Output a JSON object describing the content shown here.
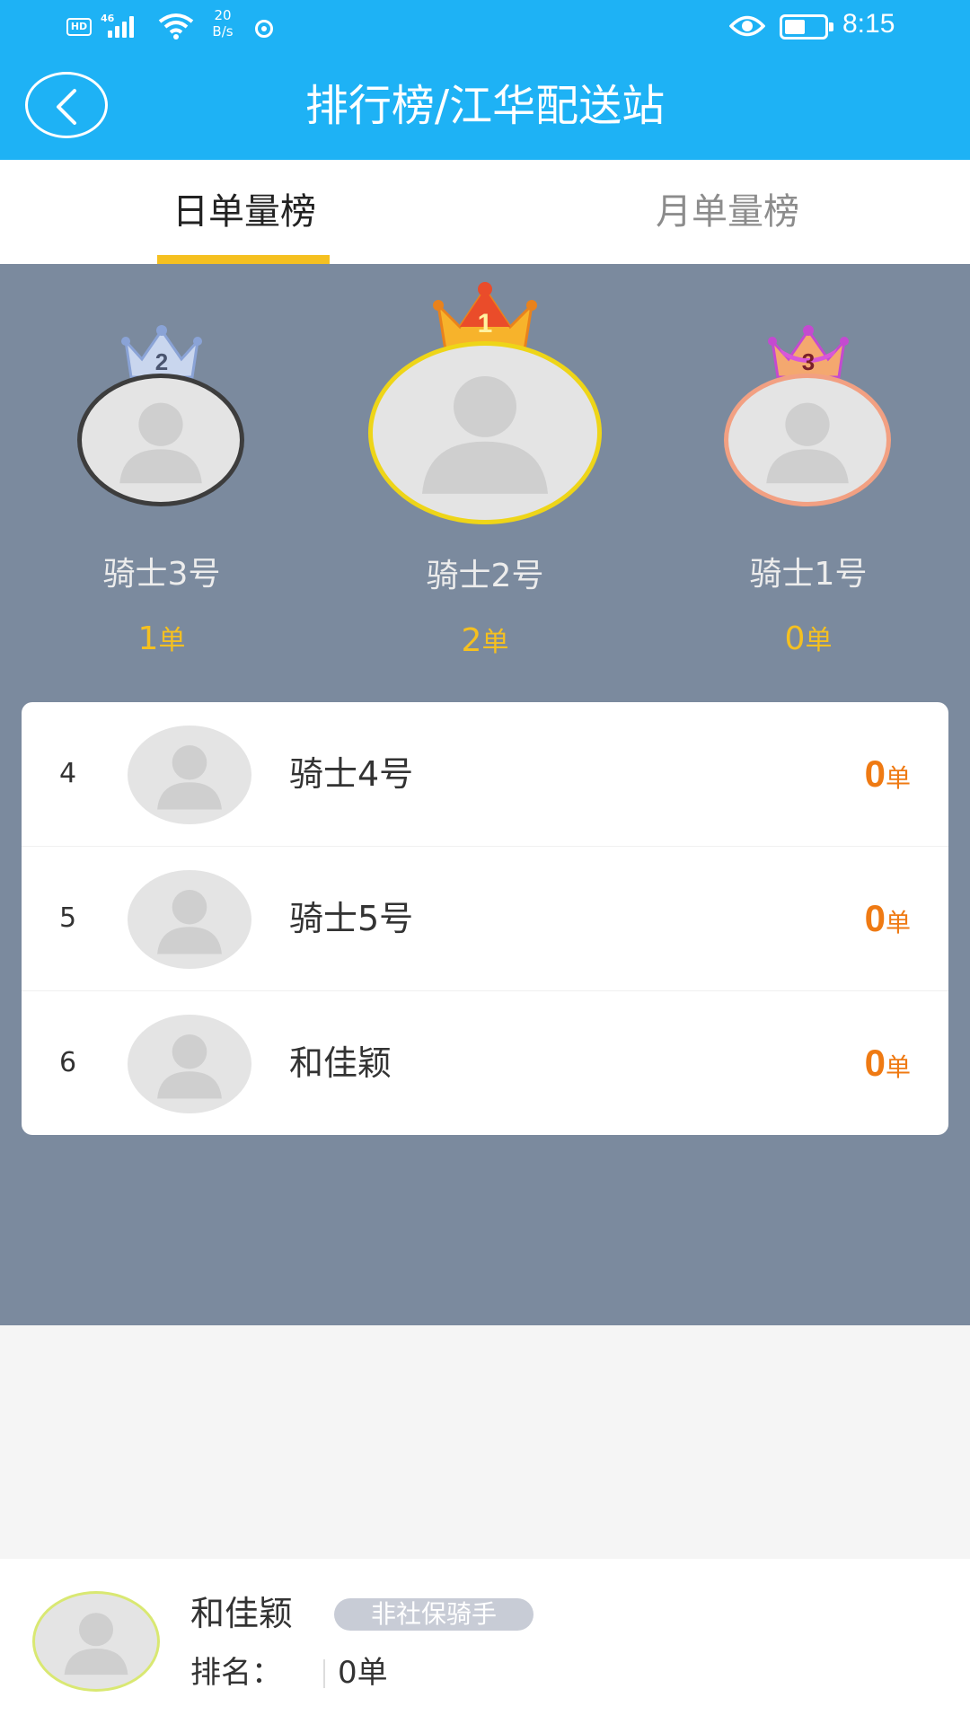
{
  "status_bar": {
    "hd": "HD",
    "network": "46",
    "speed_value": "20",
    "speed_unit": "B/s",
    "time": "8:15"
  },
  "header": {
    "title": "排行榜/江华配送站",
    "back_icon": "chevron-left-icon",
    "bg_color": "#1eb2f5"
  },
  "tabs": [
    {
      "label": "日单量榜",
      "active": true
    },
    {
      "label": "月单量榜",
      "active": false
    }
  ],
  "colors": {
    "accent": "#f5c020",
    "count_orange": "#ef7a13",
    "podium_bg": "#7b8a9e"
  },
  "podium": [
    {
      "place": "2",
      "name": "骑士3号",
      "count": "1",
      "unit": "单",
      "crown_color": "silver-blue"
    },
    {
      "place": "1",
      "name": "骑士2号",
      "count": "2",
      "unit": "单",
      "crown_color": "gold"
    },
    {
      "place": "3",
      "name": "骑士1号",
      "count": "0",
      "unit": "单",
      "crown_color": "pink"
    }
  ],
  "ranking": [
    {
      "rank": "4",
      "name": "骑士4号",
      "count": "0",
      "unit": "单"
    },
    {
      "rank": "5",
      "name": "骑士5号",
      "count": "0",
      "unit": "单"
    },
    {
      "rank": "6",
      "name": "和佳颖",
      "count": "0",
      "unit": "单"
    }
  ],
  "self": {
    "name": "和佳颖",
    "tag": "非社保骑手",
    "rank_label": "排名：",
    "count_text": "0单"
  }
}
